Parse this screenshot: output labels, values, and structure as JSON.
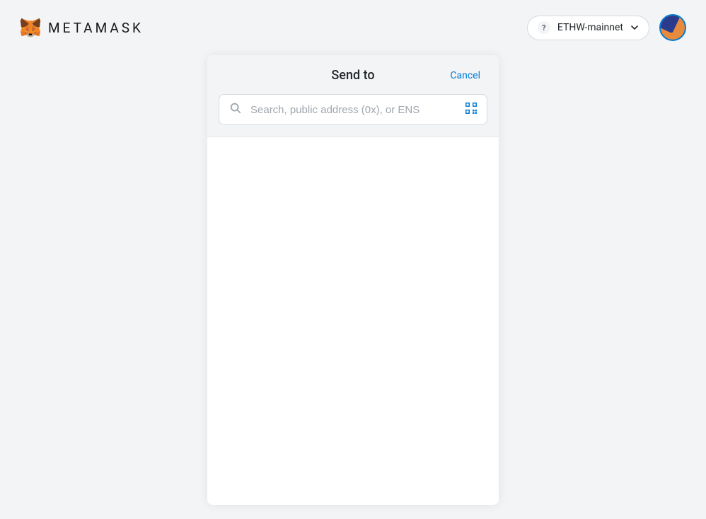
{
  "header": {
    "brand": "METAMASK",
    "network": {
      "name": "ETHW-mainnet",
      "icon": "?"
    }
  },
  "send": {
    "title": "Send to",
    "cancel": "Cancel",
    "search_placeholder": "Search, public address (0x), or ENS"
  }
}
